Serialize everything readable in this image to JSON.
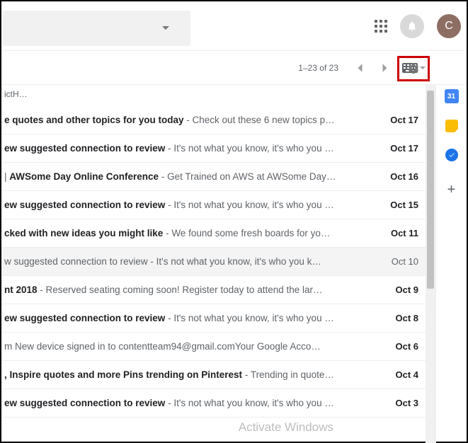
{
  "header": {
    "avatar_initial": "C"
  },
  "toolbar": {
    "pager_text": "1–23 of 23"
  },
  "sidebar": {
    "calendar_day": "31"
  },
  "snippet_header": "ictH…",
  "emails": [
    {
      "unread": true,
      "subject": "e quotes and other topics for you today",
      "preview": "Check out these 6 new topics p…",
      "date": "Oct 17",
      "sep": " - "
    },
    {
      "unread": true,
      "subject": "ew suggested connection to review",
      "preview": "It's not what you know, it's who you …",
      "date": "Oct 17",
      "sep": " - "
    },
    {
      "unread": true,
      "subject": "AWSome Day Online Conference",
      "prefix": " | ",
      "preview": "Get Trained on AWS at AWSome Day…",
      "date": "Oct 16",
      "sep": " - "
    },
    {
      "unread": true,
      "subject": "ew suggested connection to review",
      "preview": "It's not what you know, it's who you …",
      "date": "Oct 15",
      "sep": " - "
    },
    {
      "unread": true,
      "subject": "cked with new ideas you might like",
      "preview": "We found some fresh boards for yo…",
      "date": "Oct 11",
      "sep": " - "
    },
    {
      "unread": false,
      "subject": "w suggested connection to review",
      "preview": "It's not what you know, it's who you k…",
      "date": "Oct 10",
      "sep": " - "
    },
    {
      "unread": true,
      "subject": "nt 2018",
      "preview": "Reserved seating coming soon! Register today to attend the lar…",
      "date": "Oct 9",
      "sep": " - "
    },
    {
      "unread": true,
      "subject": "ew suggested connection to review",
      "preview": "It's not what you know, it's who you …",
      "date": "Oct 8",
      "sep": " - "
    },
    {
      "unread": true,
      "subject": "",
      "preview": "m New device signed in to contentteam94@gmail.comYour Google Acco…",
      "date": "Oct 6",
      "sep": ""
    },
    {
      "unread": true,
      "subject": ", Inspire quotes and more Pins trending on Pinterest",
      "preview": "Trending in quote…",
      "date": "Oct 4",
      "sep": " - "
    },
    {
      "unread": true,
      "subject": "ew suggested connection to review",
      "preview": "It's not what you know, it's who you …",
      "date": "Oct 3",
      "sep": " - "
    }
  ],
  "watermark": "Activate Windows"
}
